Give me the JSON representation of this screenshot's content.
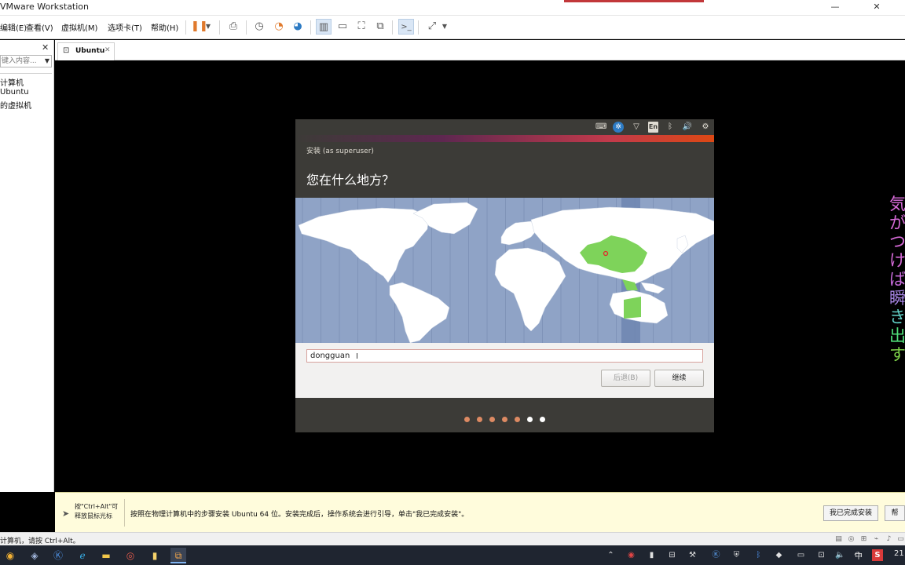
{
  "window": {
    "title": "VMware Workstation",
    "minimize": "—",
    "close": "✕"
  },
  "menu": [
    {
      "label": "编辑(E)"
    },
    {
      "label": "查看(V)"
    },
    {
      "label": "虚拟机(M)"
    },
    {
      "label": "选项卡(T)"
    },
    {
      "label": "帮助(H)"
    }
  ],
  "toolbar_icons": [
    "pause-icon",
    "dropdown-arrow-icon",
    "send-keys-icon",
    "snapshot-icon",
    "revert-snapshot-icon",
    "snapshot-manager-icon",
    "library-view-icon",
    "thumbnail-view-icon",
    "fullscreen-icon",
    "unity-icon",
    "console-icon",
    "stretch-icon"
  ],
  "library": {
    "close": "✕",
    "search_placeholder": "键入内容...",
    "items": [
      {
        "label": "计算机"
      },
      {
        "label": "Ubuntu"
      },
      {
        "label": "的虚拟机"
      }
    ]
  },
  "tab": {
    "label": "Ubuntu",
    "close": "✕"
  },
  "installer": {
    "title": "安装 (as superuser)",
    "question": "您在什么地方？",
    "panel_en": "En",
    "city_value": "dongguan",
    "back_label": "后退(B)",
    "next_label": "继续",
    "step_total": 7,
    "step_current": 5
  },
  "subtitle": {
    "text": "気がつけば瞬き出す",
    "colors": [
      "#d66ad8",
      "#d66ad8",
      "#d66ad8",
      "#d66ad8",
      "#c86cdc",
      "#a886e6",
      "#62d2c8",
      "#50e07a",
      "#7ed24a"
    ]
  },
  "hint": {
    "release": "按\"Ctrl+Alt\"可释放鼠标光标",
    "message": "按照在物理计算机中的步骤安装 Ubuntu 64 位。安装完成后，操作系统会进行引导，单击\"我已完成安装\"。",
    "done_button": "我已完成安装",
    "help_button": "帮"
  },
  "status": {
    "text": "计算机，请按 Ctrl+Alt。"
  },
  "taskbar": {
    "ime": "中",
    "clock": "21"
  },
  "colors": {
    "ubuntu_dark": "#3c3b37",
    "ubuntu_orange": "#dd4814",
    "map_ocean": "#8fa3c6",
    "map_land": "#ffffff",
    "timezone_highlight": "#7ed35a",
    "hint_background": "#fffcdc"
  }
}
